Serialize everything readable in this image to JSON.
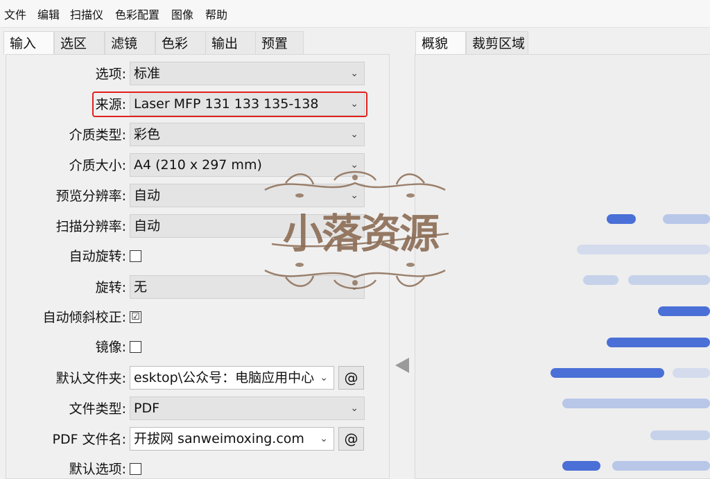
{
  "menu": [
    "文件",
    "编辑",
    "扫描仪",
    "色彩配置",
    "图像",
    "帮助"
  ],
  "left_tabs": [
    "输入",
    "选区",
    "滤镜",
    "色彩",
    "输出",
    "预置"
  ],
  "right_tabs": [
    "概貌",
    "裁剪区域"
  ],
  "fields": {
    "option": {
      "label": "选项:",
      "value": "标准"
    },
    "source": {
      "label": "来源:",
      "value": "Laser MFP 131 133 135-138"
    },
    "media_type": {
      "label": "介质类型:",
      "value": "彩色"
    },
    "media_size": {
      "label": "介质大小:",
      "value": "A4 (210 x 297 mm)"
    },
    "preview_res": {
      "label": "预览分辨率:",
      "value": "自动"
    },
    "scan_res": {
      "label": "扫描分辨率:",
      "value": "自动"
    },
    "auto_rotate": {
      "label": "自动旋转:",
      "checked": false
    },
    "rotate": {
      "label": "旋转:",
      "value": "无"
    },
    "auto_deskew": {
      "label": "自动倾斜校正:",
      "checked": true,
      "mark": "☑"
    },
    "mirror": {
      "label": "镜像:",
      "checked": false
    },
    "default_folder": {
      "label": "默认文件夹:",
      "value": "esktop\\公众号：电脑应用中心",
      "button": "@"
    },
    "file_type": {
      "label": "文件类型:",
      "value": "PDF"
    },
    "pdf_filename": {
      "label": "PDF 文件名:",
      "value": "开拔网 sanweimoxing.com",
      "button": "@"
    },
    "default_option": {
      "label": "默认选项:",
      "checked": false
    }
  },
  "watermark": {
    "text": "小落资源"
  },
  "colors": {
    "highlight": "#e0201d",
    "bar_dark": "#4a6fd6",
    "bar_light": "#b8c6e8",
    "bar_pale": "#d3dbed"
  }
}
